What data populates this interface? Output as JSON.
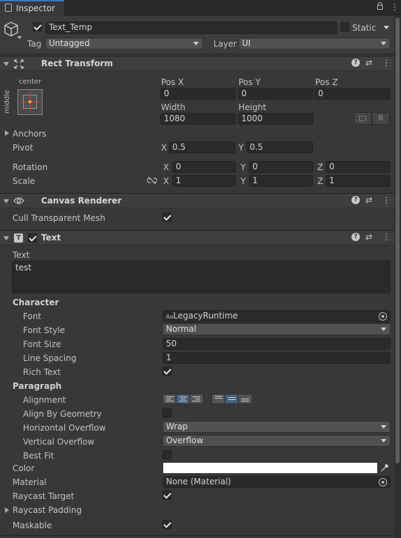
{
  "tab": {
    "title": "Inspector"
  },
  "gameobject": {
    "active": true,
    "name": "Text_Temp",
    "static_label": "Static",
    "static_checked": false,
    "tag_label": "Tag",
    "tag_value": "Untagged",
    "layer_label": "Layer",
    "layer_value": "UI"
  },
  "rect_transform": {
    "title": "Rect Transform",
    "anchor_h": "center",
    "anchor_v": "middle",
    "labels": {
      "posx": "Pos X",
      "posy": "Pos Y",
      "posz": "Pos Z",
      "width": "Width",
      "height": "Height"
    },
    "posx": "0",
    "posy": "0",
    "posz": "0",
    "width": "1080",
    "height": "1000",
    "r_button": "R",
    "anchors_label": "Anchors",
    "pivot_label": "Pivot",
    "pivot": {
      "x_label": "X",
      "x": "0.5",
      "y_label": "Y",
      "y": "0.5"
    },
    "rotation_label": "Rotation",
    "rotation": {
      "x_label": "X",
      "x": "0",
      "y_label": "Y",
      "y": "0",
      "z_label": "Z",
      "z": "0"
    },
    "scale_label": "Scale",
    "scale": {
      "x_label": "X",
      "x": "1",
      "y_label": "Y",
      "y": "1",
      "z_label": "Z",
      "z": "1"
    }
  },
  "canvas_renderer": {
    "title": "Canvas Renderer",
    "cull_label": "Cull Transparent Mesh",
    "cull_checked": true
  },
  "text_component": {
    "title": "Text",
    "enabled": true,
    "text_label": "Text",
    "text_value": "test",
    "character_label": "Character",
    "font_label": "Font",
    "font_prefix": "Aa",
    "font_value": "LegacyRuntime",
    "font_style_label": "Font Style",
    "font_style_value": "Normal",
    "font_size_label": "Font Size",
    "font_size_value": "50",
    "line_spacing_label": "Line Spacing",
    "line_spacing_value": "1",
    "rich_text_label": "Rich Text",
    "rich_text_checked": true,
    "paragraph_label": "Paragraph",
    "alignment_label": "Alignment",
    "align_by_geometry_label": "Align By Geometry",
    "align_by_geometry_checked": false,
    "horizontal_overflow_label": "Horizontal Overflow",
    "horizontal_overflow_value": "Wrap",
    "vertical_overflow_label": "Vertical Overflow",
    "vertical_overflow_value": "Overflow",
    "best_fit_label": "Best Fit",
    "best_fit_checked": false,
    "color_label": "Color",
    "color_value": "#ffffff",
    "material_label": "Material",
    "material_value": "None (Material)",
    "raycast_target_label": "Raycast Target",
    "raycast_target_checked": true,
    "raycast_padding_label": "Raycast Padding",
    "maskable_label": "Maskable",
    "maskable_checked": true
  },
  "colors": {
    "background": "#383838",
    "field": "#2a2a2a",
    "accent_selected": "#46607c",
    "anchor_red": "#d04040",
    "anchor_orange": "#e8a13a"
  }
}
